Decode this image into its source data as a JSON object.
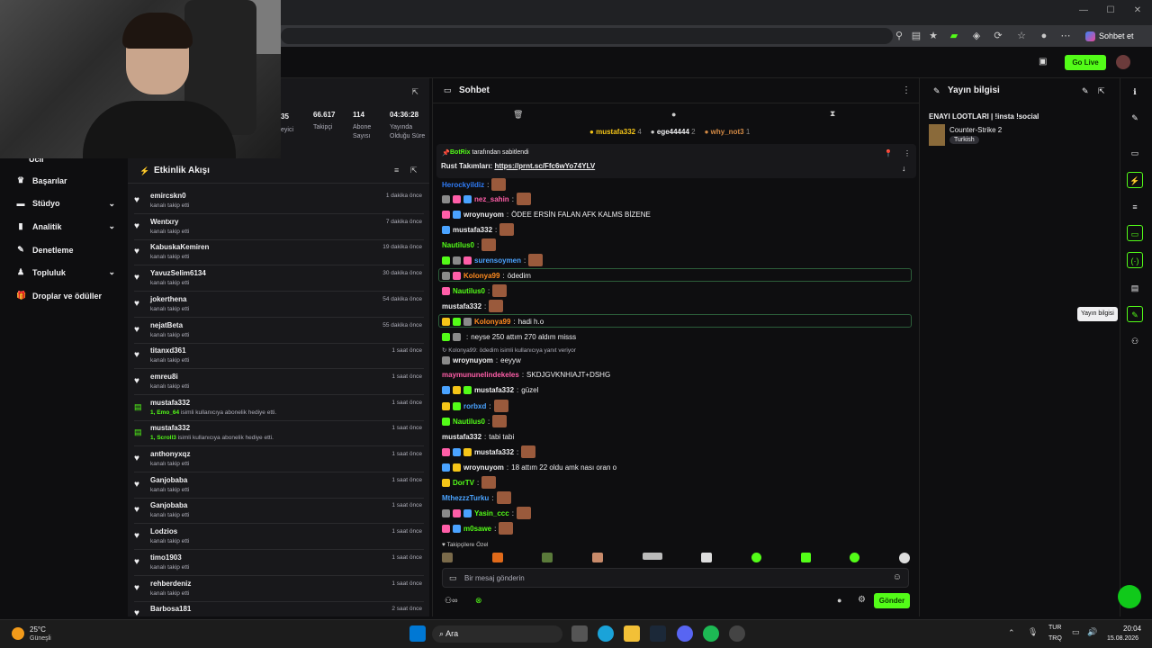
{
  "browser": {
    "sohbet_label": "Sohbet et"
  },
  "app": {
    "go_live": "Go Live"
  },
  "sidebar": {
    "items": [
      {
        "label": "Başarılar"
      },
      {
        "label": "Stüdyo"
      },
      {
        "label": "Analitik"
      },
      {
        "label": "Denetleme"
      },
      {
        "label": "Topluluk"
      },
      {
        "label": "Droplar ve ödüller"
      }
    ]
  },
  "stats": [
    {
      "num": "66.617",
      "label": "Takipçi"
    },
    {
      "num": "114",
      "label": "Abone Sayısı"
    },
    {
      "num": "04:36:28",
      "label": "Yayında Olduğu Süre"
    }
  ],
  "activity": {
    "title": "Etkinlik Akışı",
    "rows": [
      {
        "name": "emircskn0",
        "desc": "kanalı takip etti",
        "time": "1 dakika önce"
      },
      {
        "name": "Wentxry",
        "desc": "kanalı takip etti",
        "time": "7 dakika önce"
      },
      {
        "name": "KabuskaKemiren",
        "desc": "kanalı takip etti",
        "time": "19 dakika önce"
      },
      {
        "name": "YavuzSelim6134",
        "desc": "kanalı takip etti",
        "time": "30 dakika önce"
      },
      {
        "name": "jokerthena",
        "desc": "kanalı takip etti",
        "time": "54 dakika önce"
      },
      {
        "name": "nejatBeta",
        "desc": "kanalı takip etti",
        "time": "55 dakika önce"
      },
      {
        "name": "titanxd361",
        "desc": "kanalı takip etti",
        "time": "1 saat önce"
      },
      {
        "name": "emreu8i",
        "desc": "kanalı takip etti",
        "time": "1 saat önce"
      },
      {
        "name": "mustafa332",
        "gift": "1, Emo_64",
        "desc": "isimli kullanıcıya abonelik hediye etti.",
        "time": "1 saat önce"
      },
      {
        "name": "mustafa332",
        "gift": "1, Scroll3",
        "desc": "isimli kullanıcıya abonelik hediye etti.",
        "time": "1 saat önce"
      },
      {
        "name": "anthonyxqz",
        "desc": "kanalı takip etti",
        "time": "1 saat önce"
      },
      {
        "name": "Ganjobaba",
        "desc": "kanalı takip etti",
        "time": "1 saat önce"
      },
      {
        "name": "Ganjobaba",
        "desc": "kanalı takip etti",
        "time": "1 saat önce"
      },
      {
        "name": "Lodzios",
        "desc": "kanalı takip etti",
        "time": "1 saat önce"
      },
      {
        "name": "timo1903",
        "desc": "kanalı takip etti",
        "time": "1 saat önce"
      },
      {
        "name": "rehberdeniz",
        "desc": "kanalı takip etti",
        "time": "1 saat önce"
      },
      {
        "name": "Barbosa181",
        "desc": "",
        "time": "2 saat önce"
      }
    ]
  },
  "chat": {
    "title": "Sohbet",
    "top_gifters": [
      {
        "name": "mustafa332",
        "count": "4"
      },
      {
        "name": "ege44444",
        "count": "2"
      },
      {
        "name": "why_not3",
        "count": "1"
      }
    ],
    "pinned": {
      "by_user": "BotRix",
      "by_label": "tarafından sabitlendi",
      "text_prefix": "Rust Takımları:",
      "link": "https://prnt.sc/Ffc6wYo74YLV"
    },
    "messages": [
      {
        "user": "Herockyildiz",
        "text": "",
        "color": "#2f7bf5"
      },
      {
        "user": "nez_sahin",
        "text": "",
        "color": "#ff5ea8"
      },
      {
        "user": "wroynuyom",
        "text": "ÖDEE ERSİN FALAN AFK KALMS BİZENE",
        "color": "#efeff1"
      },
      {
        "user": "mustafa332",
        "text": "",
        "color": "#efeff1"
      },
      {
        "user": "Nautilus0",
        "text": "",
        "color": "#53fc18"
      },
      {
        "user": "surensoymen",
        "text": "",
        "color": "#4aa3ff"
      },
      {
        "user": "Kolonya99",
        "text": "ödedim",
        "color": "#ff8a1f"
      },
      {
        "user": "Nautilus0",
        "text": "",
        "color": "#53fc18"
      },
      {
        "user": "mustafa332",
        "text": "",
        "color": "#efeff1"
      },
      {
        "user": "Kolonya99",
        "text": "hadi h.o",
        "color": "#ff8a1f"
      },
      {
        "user": "",
        "text": "neyse 250 attım 270 aldım misss",
        "color": "#4b6bff"
      },
      {
        "user": "wroynuyom",
        "text": "eeyyw",
        "color": "#efeff1"
      },
      {
        "user": "maymununelindekeles",
        "text": "SKDJGVKNHIAJT+DSHG",
        "color": "#ff5ea8"
      },
      {
        "user": "mustafa332",
        "text": "güzel",
        "color": "#efeff1"
      },
      {
        "user": "rorbxd",
        "text": "",
        "color": "#4aa3ff"
      },
      {
        "user": "Nautilus0",
        "text": "",
        "color": "#53fc18"
      },
      {
        "user": "mustafa332",
        "text": "tabi tabi",
        "color": "#efeff1"
      },
      {
        "user": "mustafa332",
        "text": "",
        "color": "#efeff1"
      },
      {
        "user": "wroynuyom",
        "text": "18 attım 22 oldu amk nası oran o",
        "color": "#efeff1"
      },
      {
        "user": "DorTV",
        "text": "",
        "color": "#53fc18"
      },
      {
        "user": "MthezzzTurku",
        "text": "",
        "color": "#4aa3ff"
      },
      {
        "user": "Yasin_ccc",
        "text": "",
        "color": "#53fc18"
      },
      {
        "user": "m0sawe",
        "text": "",
        "color": "#53fc18"
      }
    ],
    "reply_note": "Kolonya99: ödedim isimli kullanıcıya yanıt veriyor",
    "followers_only": "Takipçilere Özel",
    "input_placeholder": "Bir mesaj gönderin",
    "send_label": "Gönder"
  },
  "info_panel": {
    "title": "Yayın bilgisi",
    "stream_title": "ENAYI LOOTLARI | !insta !social",
    "game": "Counter-Strike 2",
    "tag": "Turkish",
    "tooltip": "Yayın bilgisi"
  },
  "taskbar": {
    "weather_temp": "25°C",
    "weather_desc": "Güneşli",
    "search": "Ara",
    "lang_top": "TUR",
    "lang_bottom": "TRQ",
    "time": "20:04",
    "date": "15.08.2026"
  },
  "colors": {
    "accent": "#53fc18",
    "panel": "#18181b",
    "bg": "#0e0e10"
  }
}
